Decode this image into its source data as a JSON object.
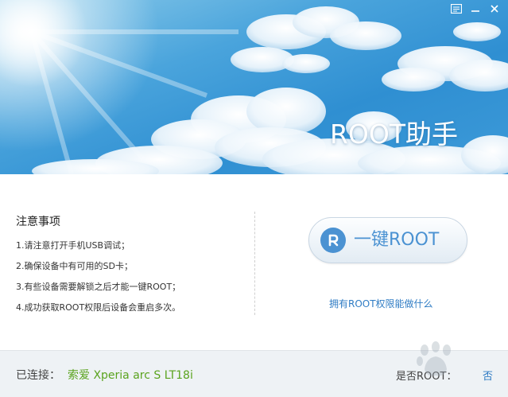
{
  "window": {
    "app_title": "ROOT助手",
    "controls": [
      "feedback-icon",
      "minimize-icon",
      "close-icon"
    ]
  },
  "notes": {
    "title": "注意事项",
    "items": [
      "1.请注意打开手机USB调试；",
      "2.确保设备中有可用的SD卡；",
      "3.有些设备需要解锁之后才能一键ROOT；",
      "4.成功获取ROOT权限后设备会重启多次。"
    ]
  },
  "root_action": {
    "button_label": "一键ROOT",
    "icon": "R",
    "link": "拥有ROOT权限能做什么"
  },
  "footer": {
    "connected_label": "已连接：",
    "device_name": "索爱 Xperia arc S LT18i",
    "root_status_label": "是否ROOT：",
    "root_status_value": "否"
  },
  "colors": {
    "accent_blue": "#4b92d2",
    "link_blue": "#2f7cc4",
    "device_green": "#5aa31e",
    "footer_bg": "#eef2f5"
  }
}
